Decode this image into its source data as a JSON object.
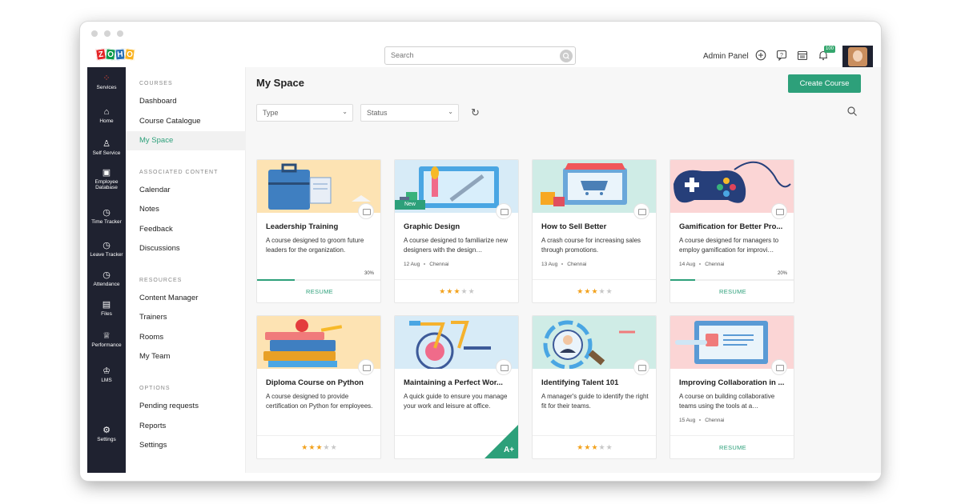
{
  "header": {
    "search_placeholder": "Search",
    "admin_label": "Admin Panel",
    "notification_count": "100",
    "logo_letters": [
      "Z",
      "O",
      "H",
      "O"
    ],
    "logo_colors": [
      "#e42527",
      "#089949",
      "#226db4",
      "#f9b21d"
    ]
  },
  "rail": [
    {
      "icon": "services-icon",
      "glyph": "⁘",
      "label": "Services"
    },
    {
      "icon": "home-icon",
      "glyph": "⌂",
      "label": "Home"
    },
    {
      "icon": "user-icon",
      "glyph": "♙",
      "label": "Self Service"
    },
    {
      "icon": "database-icon",
      "glyph": "▣",
      "label": "Employee Database"
    },
    {
      "icon": "clock-icon",
      "glyph": "◷",
      "label": "Time Tracker"
    },
    {
      "icon": "leave-icon",
      "glyph": "◷",
      "label": "Leave Tracker"
    },
    {
      "icon": "attendance-icon",
      "glyph": "◷",
      "label": "Attendance"
    },
    {
      "icon": "files-icon",
      "glyph": "▤",
      "label": "Files"
    },
    {
      "icon": "trophy-icon",
      "glyph": "♕",
      "label": "Performance"
    },
    {
      "icon": "lms-icon",
      "glyph": "♔",
      "label": "LMS"
    },
    {
      "icon": "settings-icon",
      "glyph": "⚙",
      "label": "Settings"
    }
  ],
  "menu": {
    "courses_heading": "COURSES",
    "courses": [
      "Dashboard",
      "Course Catalogue",
      "My Space"
    ],
    "associated_heading": "ASSOCIATED CONTENT",
    "associated": [
      "Calendar",
      "Notes",
      "Feedback",
      "Discussions"
    ],
    "resources_heading": "RESOURCES",
    "resources": [
      "Content Manager",
      "Trainers",
      "Rooms",
      "My Team"
    ],
    "options_heading": "OPTIONS",
    "options": [
      "Pending requests",
      "Reports",
      "Settings"
    ]
  },
  "main": {
    "title": "My Space",
    "create_label": "Create Course",
    "filter_type": "Type",
    "filter_status": "Status"
  },
  "cards": [
    {
      "title": "Leadership Training",
      "desc": "A course designed to groom future leaders for the organization.",
      "date": "",
      "location": "",
      "progress": 0.3,
      "progress_label": "30%",
      "footer": "RESUME",
      "rating": null,
      "tag": "",
      "grade": "",
      "banner_color": "#fde3b3"
    },
    {
      "title": "Graphic Design",
      "desc": "A course designed to familiarize new designers with the design…",
      "date": "12 Aug",
      "location": "Chennai",
      "progress": null,
      "progress_label": "",
      "footer": "",
      "rating": 3,
      "tag": "New",
      "grade": "",
      "banner_color": "#d7ebf7"
    },
    {
      "title": "How to Sell Better",
      "desc": "A crash course for increasing sales through promotions.",
      "date": "13 Aug",
      "location": "Chennai",
      "progress": null,
      "progress_label": "",
      "footer": "",
      "rating": 3,
      "tag": "",
      "grade": "",
      "banner_color": "#cfece6"
    },
    {
      "title": "Gamification for Better Pro...",
      "desc": "A course designed for managers to employ gamification for improvi…",
      "date": "14 Aug",
      "location": "Chennai",
      "progress": 0.2,
      "progress_label": "20%",
      "footer": "RESUME",
      "rating": null,
      "tag": "",
      "grade": "",
      "banner_color": "#fbd5d5"
    },
    {
      "title": "Diploma Course on Python",
      "desc": "A course designed to provide certification on Python for employees.",
      "date": "",
      "location": "",
      "progress": null,
      "progress_label": "",
      "footer": "",
      "rating": 3,
      "tag": "",
      "grade": "",
      "banner_color": "#fde3b3"
    },
    {
      "title": "Maintaining a Perfect Wor...",
      "desc": "A quick guide to ensure you manage your work and leisure at office.",
      "date": "",
      "location": "",
      "progress": null,
      "progress_label": "",
      "footer": "",
      "rating": null,
      "tag": "",
      "grade": "A+",
      "banner_color": "#d7ebf7"
    },
    {
      "title": "Identifying Talent 101",
      "desc": "A manager's guide to identify the right fit for their teams.",
      "date": "",
      "location": "",
      "progress": null,
      "progress_label": "",
      "footer": "",
      "rating": 3,
      "tag": "",
      "grade": "",
      "banner_color": "#cfece6"
    },
    {
      "title": "Improving Collaboration in ...",
      "desc": "A course on building collaborative teams using the tools at a…",
      "date": "15 Aug",
      "location": "Chennai",
      "progress": null,
      "progress_label": "",
      "footer": "RESUME",
      "rating": null,
      "tag": "",
      "grade": "",
      "banner_color": "#fbd5d5"
    }
  ],
  "colors": {
    "accent": "#2da07a",
    "rail": "#1f2230",
    "star": "#f2a21e"
  }
}
